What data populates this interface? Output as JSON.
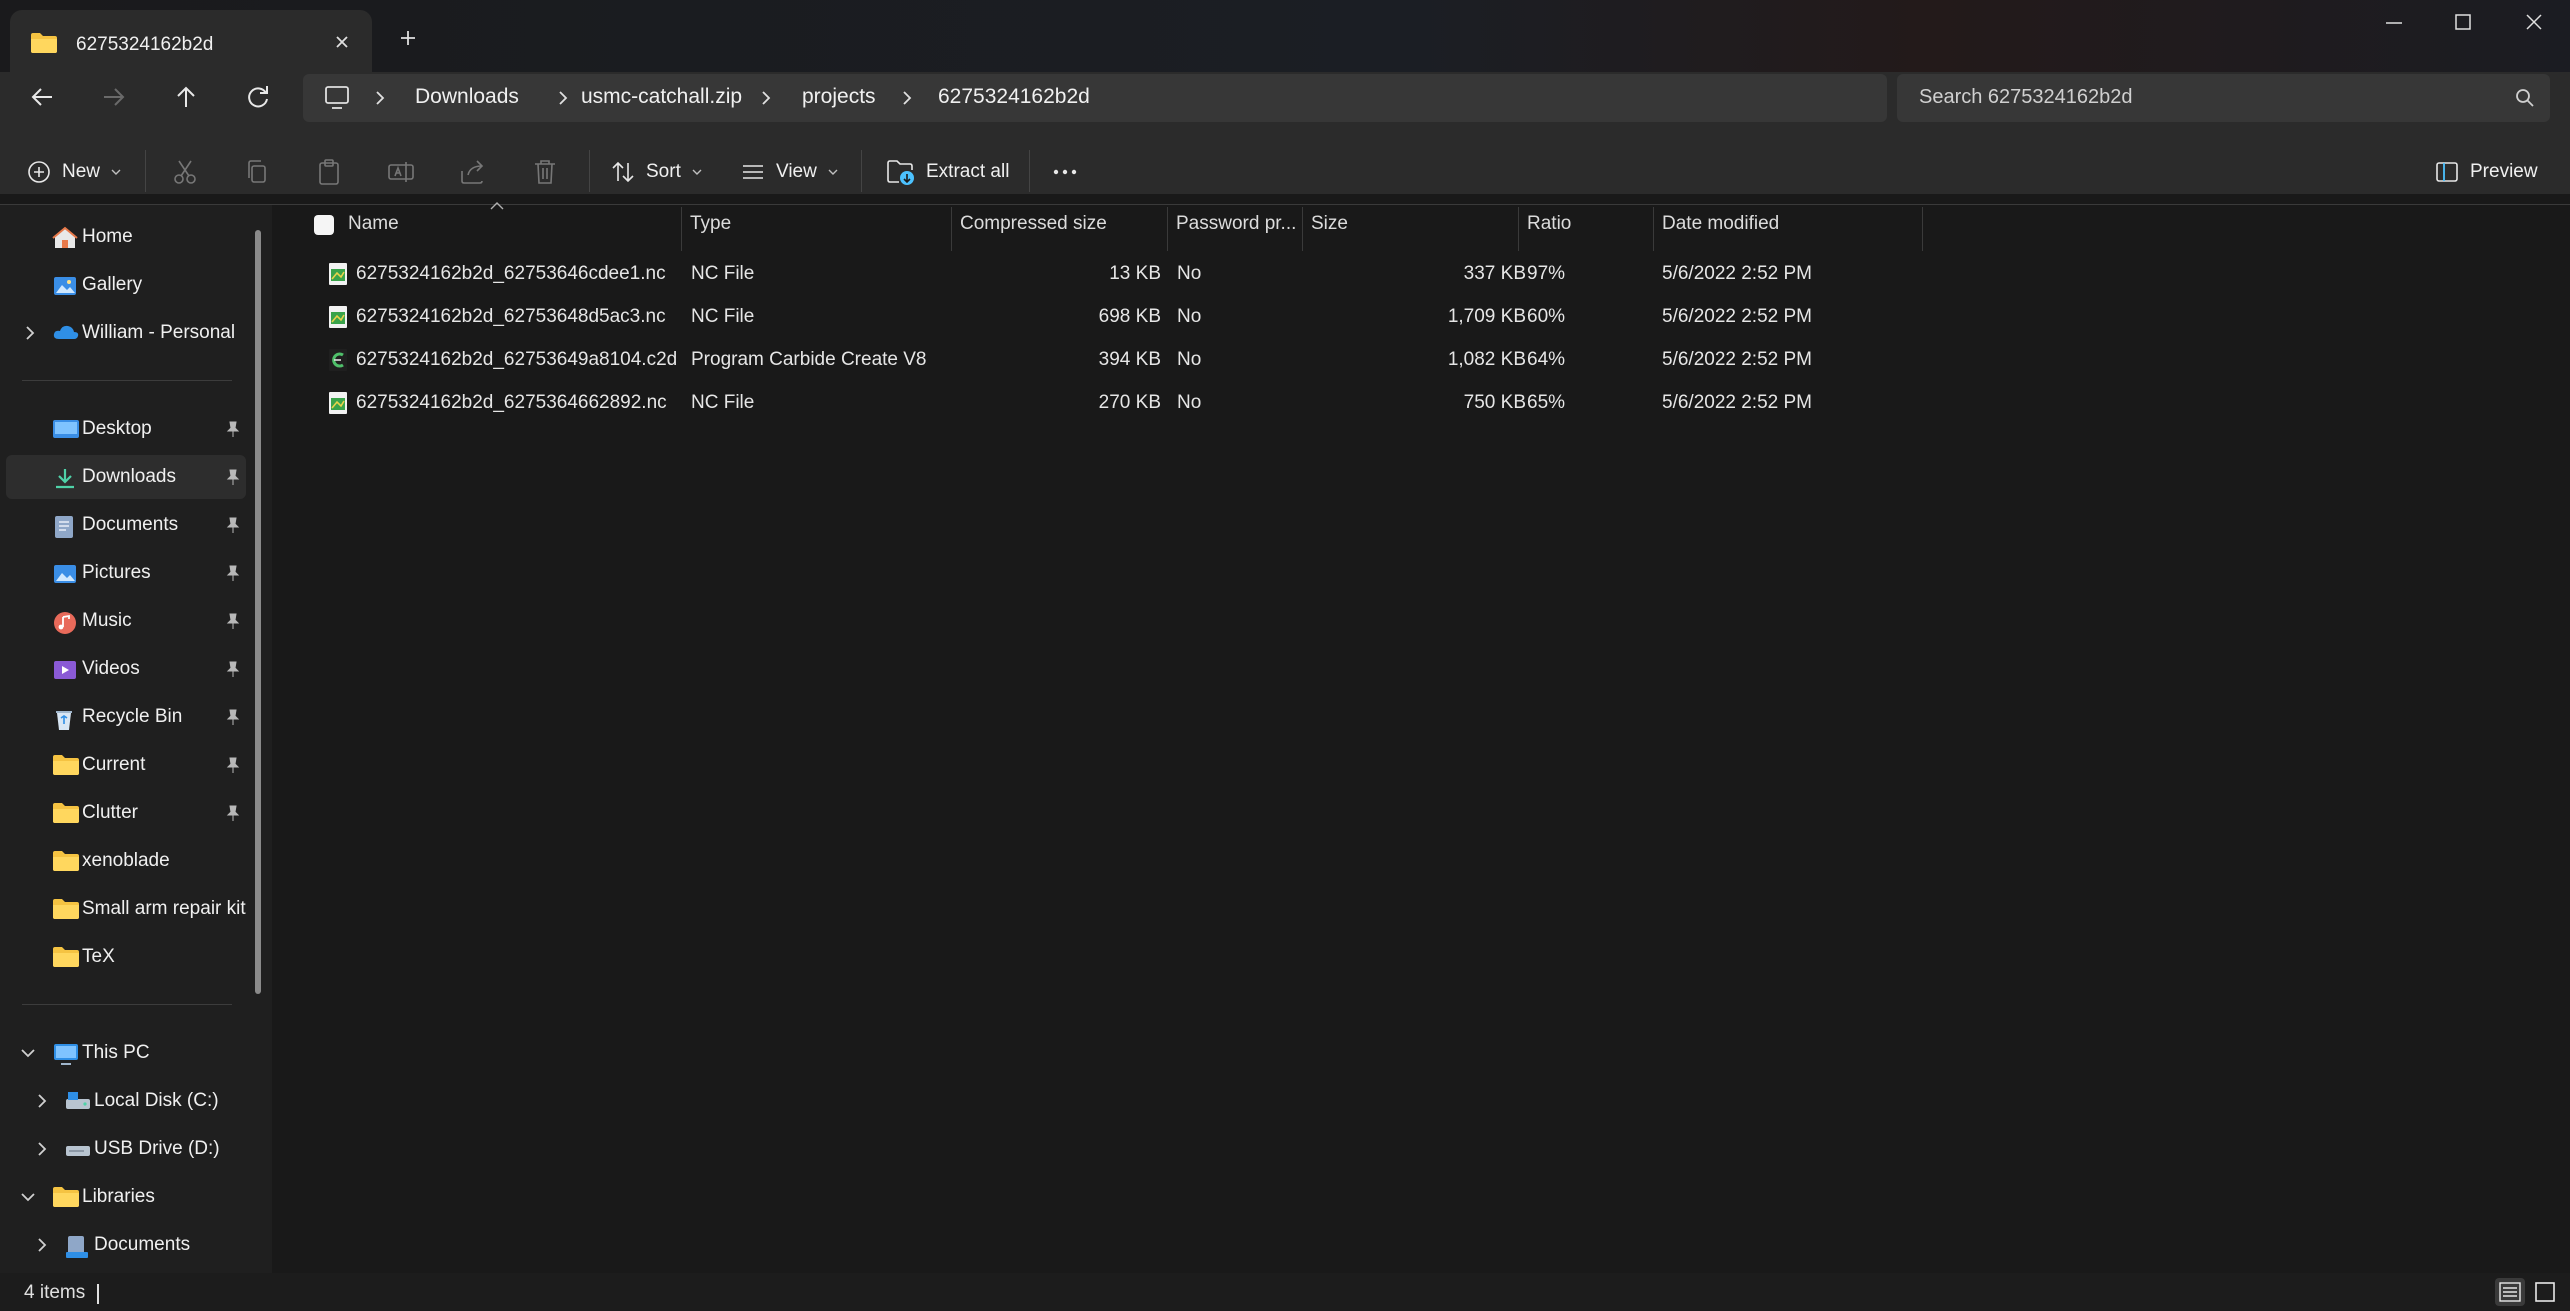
{
  "window": {
    "tab_title": "6275324162b2d",
    "controls": [
      "minimize",
      "maximize",
      "close"
    ]
  },
  "nav": {
    "breadcrumb": [
      "Downloads",
      "usmc-catchall.zip",
      "projects",
      "6275324162b2d"
    ],
    "search_placeholder": "Search 6275324162b2d"
  },
  "commands": {
    "new": "New",
    "sort": "Sort",
    "view": "View",
    "extract_all": "Extract all",
    "preview": "Preview"
  },
  "sidebar": {
    "top": [
      {
        "label": "Home",
        "icon": "home-icon"
      },
      {
        "label": "Gallery",
        "icon": "gallery-icon"
      },
      {
        "label": "William - Personal",
        "icon": "onedrive-icon",
        "expandable": true
      }
    ],
    "pinned": [
      {
        "label": "Desktop",
        "icon": "desktop-folder-icon",
        "pinned": true
      },
      {
        "label": "Downloads",
        "icon": "downloads-folder-icon",
        "pinned": true,
        "selected": true
      },
      {
        "label": "Documents",
        "icon": "documents-folder-icon",
        "pinned": true
      },
      {
        "label": "Pictures",
        "icon": "pictures-folder-icon",
        "pinned": true
      },
      {
        "label": "Music",
        "icon": "music-folder-icon",
        "pinned": true
      },
      {
        "label": "Videos",
        "icon": "videos-folder-icon",
        "pinned": true
      },
      {
        "label": "Recycle Bin",
        "icon": "recycle-bin-icon",
        "pinned": true
      },
      {
        "label": "Current",
        "icon": "folder-icon",
        "pinned": true
      },
      {
        "label": "Clutter",
        "icon": "folder-icon",
        "pinned": true
      },
      {
        "label": "xenoblade",
        "icon": "folder-icon"
      },
      {
        "label": "Small arm repair kit",
        "icon": "folder-icon"
      },
      {
        "label": "TeX",
        "icon": "folder-icon"
      }
    ],
    "tree": [
      {
        "label": "This PC",
        "icon": "pc-icon",
        "expanded": true
      },
      {
        "label": "Local Disk (C:)",
        "icon": "disk-icon",
        "child": true
      },
      {
        "label": "USB Drive (D:)",
        "icon": "usb-drive-icon",
        "child": true
      },
      {
        "label": "Libraries",
        "icon": "folder-icon",
        "expanded": true
      },
      {
        "label": "Documents",
        "icon": "documents-library-icon",
        "child": true
      }
    ]
  },
  "columns": [
    "Name",
    "Type",
    "Compressed size",
    "Password pr...",
    "Size",
    "Ratio",
    "Date modified"
  ],
  "files": [
    {
      "name": "6275324162b2d_62753646cdee1.nc",
      "type": "NC File",
      "compressed": "13 KB",
      "password": "No",
      "size": "337 KB",
      "ratio": "97%",
      "date": "5/6/2022 2:52 PM",
      "icon": "nc-file-icon"
    },
    {
      "name": "6275324162b2d_62753648d5ac3.nc",
      "type": "NC File",
      "compressed": "698 KB",
      "password": "No",
      "size": "1,709 KB",
      "ratio": "60%",
      "date": "5/6/2022 2:52 PM",
      "icon": "nc-file-icon"
    },
    {
      "name": "6275324162b2d_62753649a8104.c2d",
      "type": "Program Carbide Create V8",
      "compressed": "394 KB",
      "password": "No",
      "size": "1,082 KB",
      "ratio": "64%",
      "date": "5/6/2022 2:52 PM",
      "icon": "carbide-file-icon"
    },
    {
      "name": "6275324162b2d_6275364662892.nc",
      "type": "NC File",
      "compressed": "270 KB",
      "password": "No",
      "size": "750 KB",
      "ratio": "65%",
      "date": "5/6/2022 2:52 PM",
      "icon": "nc-file-icon"
    }
  ],
  "status": {
    "item_count": "4 items"
  },
  "colors": {
    "accent": "#4cc2ff",
    "folder": "#f5c342",
    "selected": "#2d2d2d"
  }
}
